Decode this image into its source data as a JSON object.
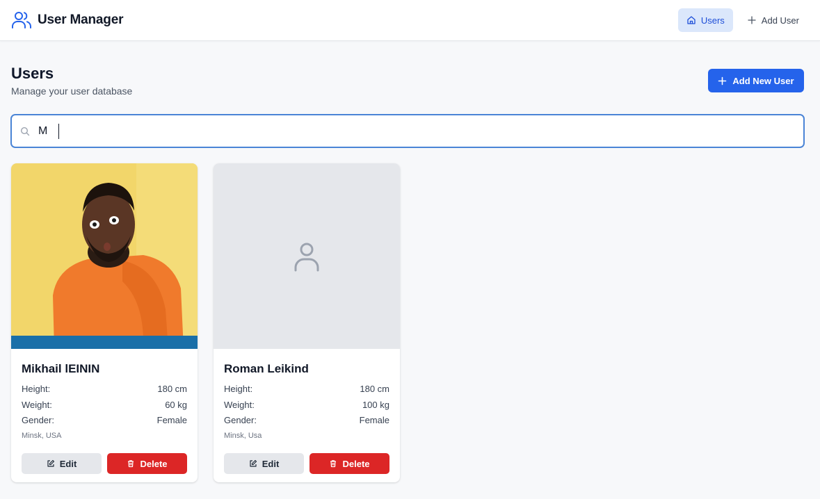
{
  "app": {
    "title": "User Manager",
    "accent_color": "#2563eb",
    "danger_color": "#dc2626"
  },
  "nav": {
    "items": [
      {
        "label": "Users",
        "icon": "home-icon",
        "active": true
      },
      {
        "label": "Add User",
        "icon": "plus-icon",
        "active": false
      }
    ]
  },
  "page": {
    "title": "Users",
    "subtitle": "Manage your user database",
    "add_button_label": "Add New User"
  },
  "search": {
    "value": "M",
    "icon": "search-icon"
  },
  "users": [
    {
      "name": "Mikhail lEININ",
      "height_label": "Height:",
      "height": "180 cm",
      "weight_label": "Weight:",
      "weight": "60 kg",
      "gender_label": "Gender:",
      "gender": "Female",
      "location": "Minsk, USA",
      "has_photo": true,
      "edit_label": "Edit",
      "delete_label": "Delete"
    },
    {
      "name": "Roman Leikind",
      "height_label": "Height:",
      "height": "180 cm",
      "weight_label": "Weight:",
      "weight": "100 kg",
      "gender_label": "Gender:",
      "gender": "Female",
      "location": "Minsk, Usa",
      "has_photo": false,
      "edit_label": "Edit",
      "delete_label": "Delete"
    }
  ]
}
